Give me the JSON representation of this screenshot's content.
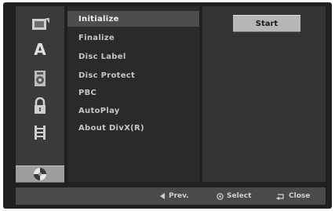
{
  "rail": {
    "items": [
      {
        "icon": "disc-settings-icon",
        "selected": false
      },
      {
        "icon": "language-icon",
        "glyph": "A",
        "selected": false
      },
      {
        "icon": "audio-icon",
        "selected": false
      },
      {
        "icon": "lock-icon",
        "selected": false
      },
      {
        "icon": "recording-icon",
        "selected": false
      },
      {
        "icon": "disc-icon",
        "selected": true
      }
    ]
  },
  "menu": {
    "items": [
      {
        "label": "Initialize",
        "selected": true
      },
      {
        "label": "Finalize",
        "selected": false
      },
      {
        "label": "Disc Label",
        "selected": false
      },
      {
        "label": "Disc Protect",
        "selected": false
      },
      {
        "label": "PBC",
        "selected": false
      },
      {
        "label": "AutoPlay",
        "selected": false
      },
      {
        "label": "About DivX(R)",
        "selected": false
      }
    ]
  },
  "action": {
    "start_label": "Start"
  },
  "footer": {
    "prev_label": "Prev.",
    "select_label": "Select",
    "close_label": "Close"
  },
  "colors": {
    "background": "#202020",
    "highlight": "#9e9e9e",
    "text": "#c6c6c6"
  }
}
